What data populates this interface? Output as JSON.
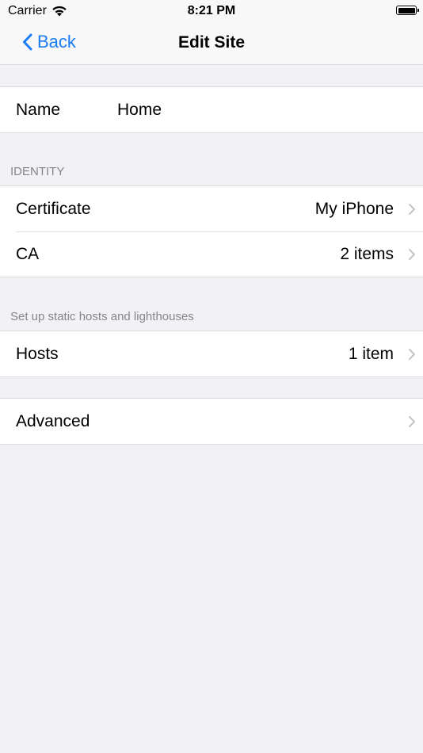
{
  "status_bar": {
    "carrier": "Carrier",
    "time": "8:21 PM"
  },
  "nav": {
    "back_label": "Back",
    "title": "Edit Site"
  },
  "name_row": {
    "label": "Name",
    "value": "Home"
  },
  "identity": {
    "header": "IDENTITY",
    "certificate_label": "Certificate",
    "certificate_value": "My iPhone",
    "ca_label": "CA",
    "ca_value": "2 items"
  },
  "hosts_section": {
    "header": "Set up static hosts and lighthouses",
    "hosts_label": "Hosts",
    "hosts_value": "1 item"
  },
  "advanced": {
    "label": "Advanced"
  },
  "colors": {
    "accent": "#1a7cf4",
    "background": "#f1f1f6",
    "cell": "#ffffff",
    "secondary_text": "#85858b"
  }
}
